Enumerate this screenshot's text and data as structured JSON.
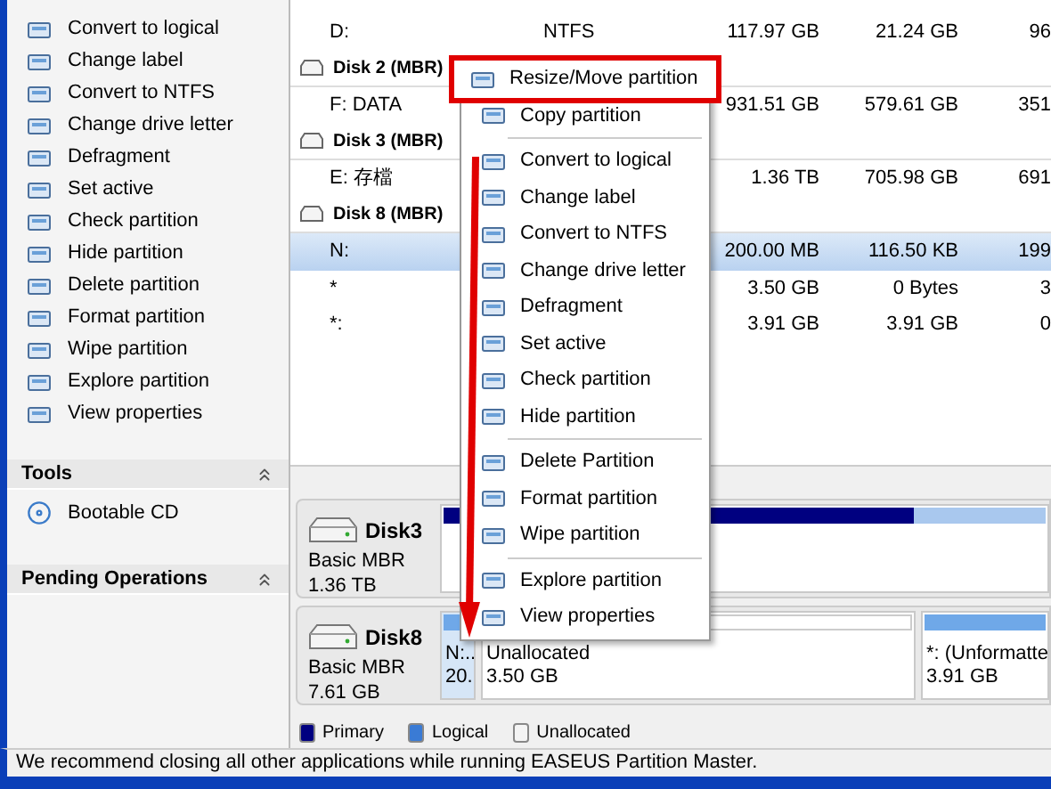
{
  "operations": [
    {
      "label": "Convert to logical"
    },
    {
      "label": "Change label"
    },
    {
      "label": "Convert to NTFS"
    },
    {
      "label": "Change drive letter"
    },
    {
      "label": "Defragment"
    },
    {
      "label": "Set active"
    },
    {
      "label": "Check partition"
    },
    {
      "label": "Hide partition"
    },
    {
      "label": "Delete partition"
    },
    {
      "label": "Format partition"
    },
    {
      "label": "Wipe partition"
    },
    {
      "label": "Explore partition"
    },
    {
      "label": "View properties"
    }
  ],
  "tools": {
    "title": "Tools",
    "items": [
      {
        "label": "Bootable CD"
      }
    ]
  },
  "pending": {
    "title": "Pending Operations"
  },
  "table": {
    "rows": [
      {
        "kind": "partition",
        "name": "D:",
        "fs": "NTFS",
        "capacity": "117.97 GB",
        "used": "21.24 GB",
        "unused": "96",
        "selected": false
      },
      {
        "kind": "disk",
        "name": "Disk 2 (MBR)",
        "selected": false
      },
      {
        "kind": "partition",
        "name": "F: DATA",
        "capacity": "931.51 GB",
        "used": "579.61 GB",
        "unused": "351",
        "selected": false
      },
      {
        "kind": "disk",
        "name": "Disk 3 (MBR)",
        "selected": false
      },
      {
        "kind": "partition",
        "name": "E: 存檔",
        "capacity": "1.36 TB",
        "used": "705.98 GB",
        "unused": "691",
        "selected": false
      },
      {
        "kind": "disk",
        "name": "Disk 8 (MBR)",
        "selected": false
      },
      {
        "kind": "partition",
        "name": "N:",
        "capacity": "200.00 MB",
        "used": "116.50 KB",
        "unused": "199",
        "selected": true
      },
      {
        "kind": "partition",
        "name": "*",
        "capacity": "3.50 GB",
        "used": "0 Bytes",
        "unused": "3",
        "selected": false
      },
      {
        "kind": "partition",
        "name": "*:",
        "capacity": "3.91 GB",
        "used": "3.91 GB",
        "unused": "0",
        "selected": false
      }
    ]
  },
  "context_menu": [
    {
      "kind": "item",
      "label": "Resize/Move partition",
      "highlighted": true
    },
    {
      "kind": "item",
      "label": "Copy partition",
      "highlighted": false
    },
    {
      "kind": "separator"
    },
    {
      "kind": "item",
      "label": "Convert to logical",
      "highlighted": false
    },
    {
      "kind": "item",
      "label": "Change label",
      "highlighted": false
    },
    {
      "kind": "item",
      "label": "Convert to NTFS",
      "highlighted": false
    },
    {
      "kind": "item",
      "label": "Change drive letter",
      "highlighted": false
    },
    {
      "kind": "item",
      "label": "Defragment",
      "highlighted": false
    },
    {
      "kind": "item",
      "label": "Set active",
      "highlighted": false
    },
    {
      "kind": "item",
      "label": "Check partition",
      "highlighted": false
    },
    {
      "kind": "item",
      "label": "Hide partition",
      "highlighted": false
    },
    {
      "kind": "separator"
    },
    {
      "kind": "item",
      "label": "Delete Partition",
      "highlighted": false
    },
    {
      "kind": "item",
      "label": "Format partition",
      "highlighted": false
    },
    {
      "kind": "item",
      "label": "Wipe partition",
      "highlighted": false
    },
    {
      "kind": "separator"
    },
    {
      "kind": "item",
      "label": "Explore partition",
      "highlighted": false
    },
    {
      "kind": "item",
      "label": "View properties",
      "highlighted": false
    }
  ],
  "disk_map": [
    {
      "name": "Disk3",
      "type": "Basic MBR",
      "size": "1.36 TB",
      "partitions": [
        {
          "kind": "primary",
          "level": 0.78
        }
      ]
    },
    {
      "name": "Disk8",
      "type": "Basic MBR",
      "size": "7.61 GB",
      "partitions": [
        {
          "kind": "logical",
          "label": "N:..",
          "size": "20.",
          "selected": true
        },
        {
          "kind": "unallocated",
          "label": "Unallocated",
          "size": "3.50 GB",
          "selected": false
        },
        {
          "kind": "logical",
          "label": "*: (Unformatte",
          "size": "3.91 GB",
          "selected": false
        }
      ]
    }
  ],
  "legend": [
    {
      "label": "Primary",
      "color": "#000080"
    },
    {
      "label": "Logical",
      "color": "#3a7bd5"
    },
    {
      "label": "Unallocated",
      "color": "#f4f4f4"
    }
  ],
  "status_bar": "We recommend closing all other applications while running EASEUS Partition Master."
}
